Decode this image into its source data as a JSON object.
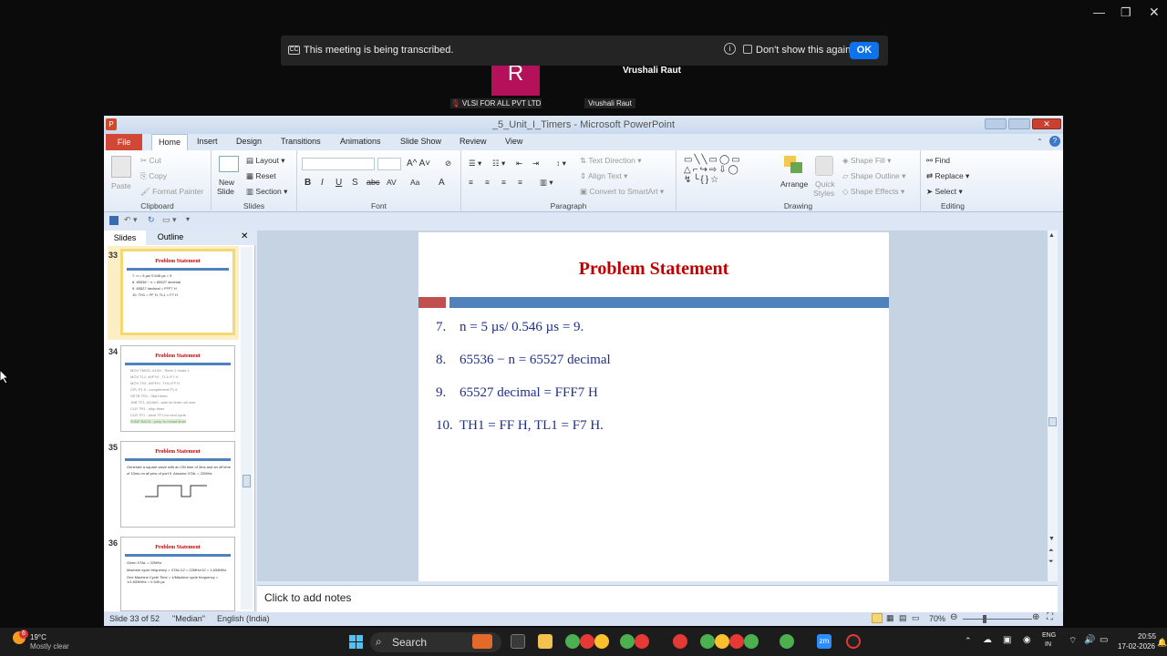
{
  "meeting": {
    "banner_text": "This meeting is being transcribed.",
    "dont_show_label": "Don't show this again",
    "ok_label": "OK",
    "avatar_letter": "R",
    "host_name": "Vrushali Raut",
    "participant_1_label": "VLSI FOR ALL PVT LTD",
    "participant_2_label": "Vrushali Raut"
  },
  "ppt": {
    "title": "_5_Unit_I_Timers - Microsoft PowerPoint",
    "tabs": [
      "File",
      "Home",
      "Insert",
      "Design",
      "Transitions",
      "Animations",
      "Slide Show",
      "Review",
      "View"
    ],
    "ribbon": {
      "clipboard": {
        "paste": "Paste",
        "cut": "Cut",
        "copy": "Copy",
        "format_painter": "Format Painter",
        "name": "Clipboard"
      },
      "slides": {
        "new_slide": "New",
        "new_slide2": "Slide",
        "layout": "Layout",
        "reset": "Reset",
        "section": "Section",
        "name": "Slides"
      },
      "font": {
        "name": "Font"
      },
      "paragraph": {
        "text_direction": "Text Direction",
        "align_text": "Align Text",
        "convert": "Convert to SmartArt",
        "name": "Paragraph"
      },
      "drawing": {
        "arrange": "Arrange",
        "quick_styles": "Quick",
        "quick_styles2": "Styles",
        "shape_fill": "Shape Fill",
        "shape_outline": "Shape Outline",
        "shape_effects": "Shape Effects",
        "name": "Drawing"
      },
      "editing": {
        "find": "Find",
        "replace": "Replace",
        "select": "Select",
        "name": "Editing"
      }
    },
    "pane_tabs": {
      "slides": "Slides",
      "outline": "Outline"
    },
    "thumbnails": [
      {
        "num": "33",
        "title": "Problem Statement",
        "lines": [
          "7.  n = 5 µs/ 0.546 µs = 9",
          "8.  65536 − n = 65527 decimal",
          "9.  65527 decimal = FFF7 H",
          "10. TH1 = FF H, TL1 = F7 H"
        ]
      },
      {
        "num": "34",
        "title": "Problem Statement",
        "lines": [
          "MOV TMOD, #10H ; Timer 1 mode 1",
          "MOV TL1, #0F7H ; TL1=F7 H",
          "MOV TH1, #0FFH ; TH1=FF H",
          "CPL P1.5 ; complement P1.5",
          "SETB TR1 ; Start timer",
          "JNB TF1, AGAIN ; wait for timer roll over",
          "CLR TR1 ; stop timer",
          "CLR TF1 ; clear TF1 for next cycle",
          "SJMP BACK ; jump to reload timer"
        ]
      },
      {
        "num": "35",
        "title": "Problem Statement",
        "lines": [
          "Generate a square wave with an ON time of 3ms and an off time",
          "of 10ms on all pins of port 0. Assume XTAL = 22MHz."
        ]
      },
      {
        "num": "36",
        "title": "Problem Statement",
        "lines": [
          "Given XTAL = 22MHz",
          "Machine cycle frequency = XTAL/12 = 22MHz/12 = 1.833MHz",
          "One Machine Cycle Time = 1/Machine cycle frequency = 1/1.833MHz = 0.545 µs"
        ]
      }
    ],
    "slide": {
      "title": "Problem Statement",
      "lines": [
        {
          "num": "7.",
          "text": "n = 5 µs/ 0.546 µs = 9."
        },
        {
          "num": "8.",
          "text": "65536 − n = 65527 decimal"
        },
        {
          "num": "9.",
          "text": "65527 decimal = FFF7 H"
        },
        {
          "num": "10.",
          "text": "TH1 = FF H, TL1 = F7 H."
        }
      ]
    },
    "notes_placeholder": "Click to add notes",
    "status": {
      "slide_of": "Slide 33 of 52",
      "theme": "\"Median\"",
      "language": "English (India)",
      "zoom": "70%"
    }
  },
  "taskbar": {
    "weather_temp": "19°C",
    "weather_desc": "Mostly clear",
    "weather_badge": "6",
    "search_label": "Search",
    "lang_1": "ENG",
    "lang_2": "IN",
    "time": "20:55",
    "date": "17-02-2026"
  },
  "colors": {
    "slide_title": "#c00000",
    "slide_text": "#1f2f8a",
    "accent_bar": "#4f81bd",
    "accent_red": "#c0504d",
    "ok_button": "#0e72ed"
  }
}
